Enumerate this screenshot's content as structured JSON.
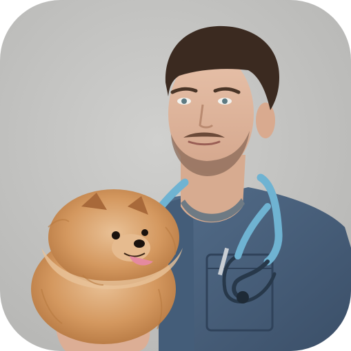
{
  "photo": {
    "subject": "veterinarian-holding-pomeranian",
    "colors": {
      "background": "#c9c9c7",
      "background_shade": "#b9b9b7",
      "scrubs": "#4b6480",
      "scrubs_dark": "#3a4f68",
      "stethoscope": "#6fb3d2",
      "stethoscope_dark": "#2a3a4a",
      "skin": "#e2b9a1",
      "skin_shade": "#cf9f86",
      "hair": "#3b2a20",
      "beard": "#8a6a58",
      "dog_fur": "#d59a62",
      "dog_fur_light": "#e8c39a",
      "dog_fur_dark": "#a8693a",
      "tongue": "#e58aa0"
    }
  }
}
